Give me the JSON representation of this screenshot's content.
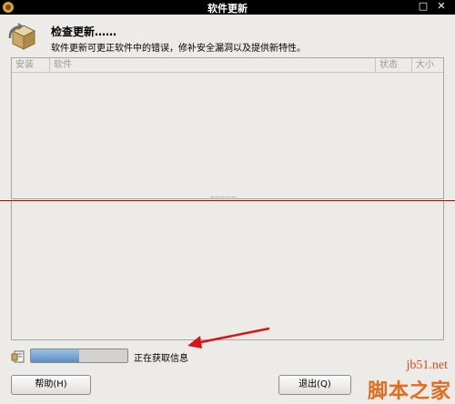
{
  "window": {
    "title": "软件更新",
    "controls": [
      "□",
      "✕"
    ]
  },
  "header": {
    "title": "检查更新……",
    "description": "软件更新可更正软件中的错误，修补安全漏洞以及提供新特性。"
  },
  "list": {
    "columns": [
      "安装",
      "软件",
      "状态",
      "大小"
    ],
    "rows": []
  },
  "status": {
    "text": "正在获取信息",
    "progress": 0.5
  },
  "buttons": {
    "help": "帮助(H)",
    "quit": "退出(Q)"
  },
  "watermark": {
    "url": "jb51.net",
    "brand": "脚本之家"
  },
  "colors": {
    "annotation_red": "#d81515",
    "divider_red": "#c40000",
    "progress_fill": "#5e8fc4"
  }
}
